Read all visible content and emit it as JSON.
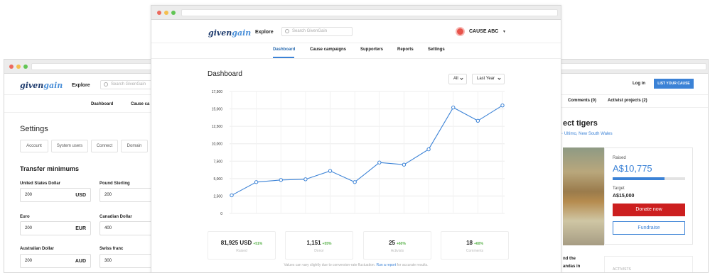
{
  "left_window": {
    "logo_a": "given",
    "logo_b": "gain",
    "explore": "Explore",
    "search_placeholder": "Search GivenGain",
    "nav": [
      "Dashboard",
      "Cause ca"
    ],
    "title": "Settings",
    "tabs": [
      "Account",
      "System users",
      "Connect",
      "Domain"
    ],
    "section": "Transfer minimums",
    "fields": [
      {
        "label": "United States Dollar",
        "value": "200",
        "unit": "USD"
      },
      {
        "label": "Pound Sterling",
        "value": "200",
        "unit": ""
      },
      {
        "label": "Euro",
        "value": "200",
        "unit": "EUR"
      },
      {
        "label": "Canadian Dollar",
        "value": "400",
        "unit": ""
      },
      {
        "label": "Australian Dollar",
        "value": "200",
        "unit": "AUD"
      },
      {
        "label": "Swiss franc",
        "value": "300",
        "unit": ""
      }
    ]
  },
  "right_window": {
    "login": "Log in",
    "cta": "LIST YOUR CAUSE",
    "tabs": [
      "Comments (0)",
      "Activist projects (2)"
    ],
    "title": "ect tigers",
    "location": "Ultimo, New South Wales",
    "raised_label": "Raised",
    "raised_amount": "A$10,775",
    "progress": 0.72,
    "target_label": "Target",
    "target_amount": "A$15,000",
    "donate": "Donate now",
    "fundraise": "Fundraise",
    "snippet1": "nd the",
    "snippet2": "andas in",
    "activists": "ACTIVISTS"
  },
  "main_window": {
    "logo_a": "given",
    "logo_b": "gain",
    "explore": "Explore",
    "search_placeholder": "Search GivenGain",
    "cause_name": "CAUSE ABC",
    "nav": [
      "Dashboard",
      "Cause campaigns",
      "Supporters",
      "Reports",
      "Settings"
    ],
    "title": "Dashboard",
    "filter_all": "All",
    "filter_period": "Last Year",
    "stats": [
      {
        "value": "81,925 USD",
        "change": "+51%",
        "caption": "Raised"
      },
      {
        "value": "1,151",
        "change": "+55%",
        "caption": "Donor"
      },
      {
        "value": "25",
        "change": "+60%",
        "caption": "Activists"
      },
      {
        "value": "18",
        "change": "+60%",
        "caption": "Comments"
      }
    ],
    "footnote": "Values can vary slightly due to conversion-rate fluctuation.",
    "footnote_link": "Run a report",
    "footnote_tail": "for accurate results."
  },
  "colors": {
    "accent": "#3b82d6",
    "donate": "#cc1f1f",
    "positive": "#56b047"
  },
  "chart_data": {
    "type": "line",
    "x": [
      1,
      2,
      3,
      4,
      5,
      6,
      7,
      8,
      9,
      10,
      11,
      12
    ],
    "series": [
      {
        "values": [
          2600,
          4500,
          4800,
          4900,
          6100,
          4500,
          7300,
          7000,
          9200,
          15200,
          13300,
          15500
        ]
      }
    ],
    "yticks": [
      "0",
      "2,500",
      "5,000",
      "7,500",
      "10,000",
      "12,500",
      "15,000",
      "17,500"
    ],
    "ylim": [
      0,
      17500
    ],
    "grid": true
  }
}
